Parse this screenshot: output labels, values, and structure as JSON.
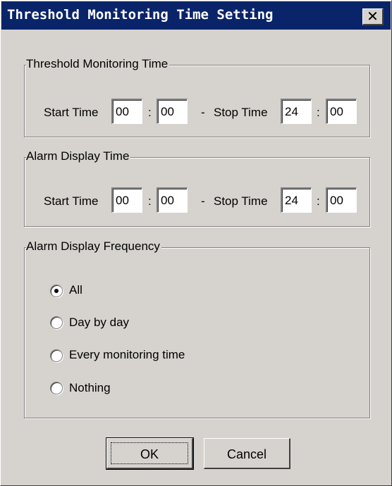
{
  "window": {
    "title": "Threshold Monitoring Time Setting",
    "close_glyph": "✕",
    "colors": {
      "titlebar": "#0a246a",
      "face": "#d6d3ce"
    }
  },
  "threshold_time": {
    "legend": "Threshold Monitoring Time",
    "start_label": "Start Time",
    "start_hour": "00",
    "start_minute": "00",
    "dash": "-",
    "stop_label": "Stop Time",
    "stop_hour": "24",
    "stop_minute": "00",
    "colon": ":"
  },
  "alarm_time": {
    "legend": "Alarm Display Time",
    "start_label": "Start Time",
    "start_hour": "00",
    "start_minute": "00",
    "dash": "-",
    "stop_label": "Stop Time",
    "stop_hour": "24",
    "stop_minute": "00",
    "colon": ":"
  },
  "frequency": {
    "legend": "Alarm Display Frequency",
    "options": [
      {
        "label": "All",
        "selected": true
      },
      {
        "label": "Day by day",
        "selected": false
      },
      {
        "label": "Every monitoring time",
        "selected": false
      },
      {
        "label": "Nothing",
        "selected": false
      }
    ]
  },
  "buttons": {
    "ok": "OK",
    "cancel": "Cancel"
  }
}
